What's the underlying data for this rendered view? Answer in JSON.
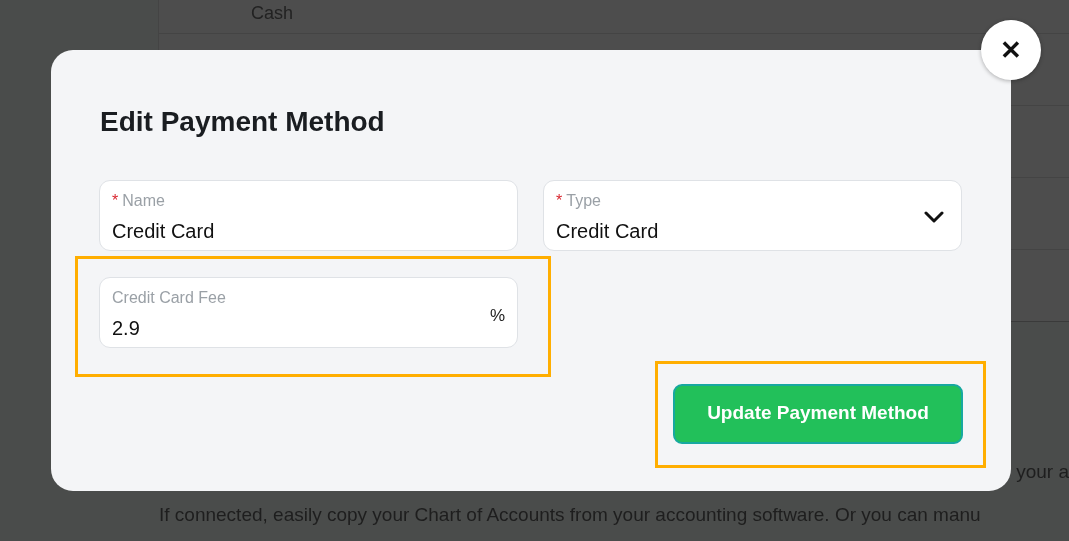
{
  "background": {
    "table_rows": [
      "Cash",
      "",
      "",
      ""
    ],
    "partial_text": "your a",
    "paragraph": "If connected, easily copy your Chart of Accounts from your accounting software. Or you can manu"
  },
  "modal": {
    "title": "Edit Payment Method",
    "close_label": "✕",
    "fields": [
      {
        "kind": "text",
        "required_mark": "*",
        "label": "Name",
        "value": "Credit Card"
      },
      {
        "kind": "select",
        "required_mark": "*",
        "label": "Type",
        "value": "Credit Card"
      },
      {
        "kind": "suffix",
        "label": "Credit Card Fee",
        "value": "2.9",
        "suffix": "%",
        "highlighted": true
      }
    ],
    "submit": {
      "label": "Update Payment Method",
      "highlighted": true
    }
  }
}
